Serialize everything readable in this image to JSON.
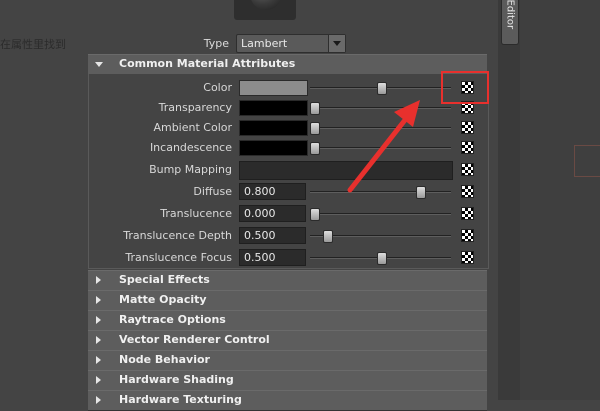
{
  "left_clip_text": "在属性里找到",
  "type_row": {
    "label": "Type",
    "value": "Lambert"
  },
  "sections": {
    "common_material": {
      "title": "Common Material Attributes",
      "expanded": true
    },
    "collapsed": [
      {
        "title": "Special Effects"
      },
      {
        "title": "Matte Opacity"
      },
      {
        "title": "Raytrace Options"
      },
      {
        "title": "Vector Renderer Control"
      },
      {
        "title": "Node Behavior"
      },
      {
        "title": "Hardware Shading"
      },
      {
        "title": "Hardware Texturing"
      }
    ]
  },
  "attributes": [
    {
      "label": "Color",
      "kind": "color",
      "swatch": "#8c8c8c",
      "slider": 0.5
    },
    {
      "label": "Transparency",
      "kind": "color",
      "swatch": "#000000",
      "slider": 0.0
    },
    {
      "label": "Ambient Color",
      "kind": "color",
      "swatch": "#000000",
      "slider": 0.0
    },
    {
      "label": "Incandescence",
      "kind": "color",
      "swatch": "#000000",
      "slider": 0.0
    },
    {
      "label": "Bump Mapping",
      "kind": "bump"
    },
    {
      "label": "Diffuse",
      "kind": "number",
      "value": "0.800",
      "slider": 0.8
    },
    {
      "label": "Translucence",
      "kind": "number",
      "value": "0.000",
      "slider": 0.0
    },
    {
      "label": "Translucence Depth",
      "kind": "number",
      "value": "0.500",
      "slider": 0.1
    },
    {
      "label": "Translucence Focus",
      "kind": "number",
      "value": "0.500",
      "slider": 0.5
    }
  ],
  "side_tab": {
    "label": "Editor"
  },
  "colors": {
    "highlight": "#e8302d",
    "arrow": "#e8302d"
  }
}
